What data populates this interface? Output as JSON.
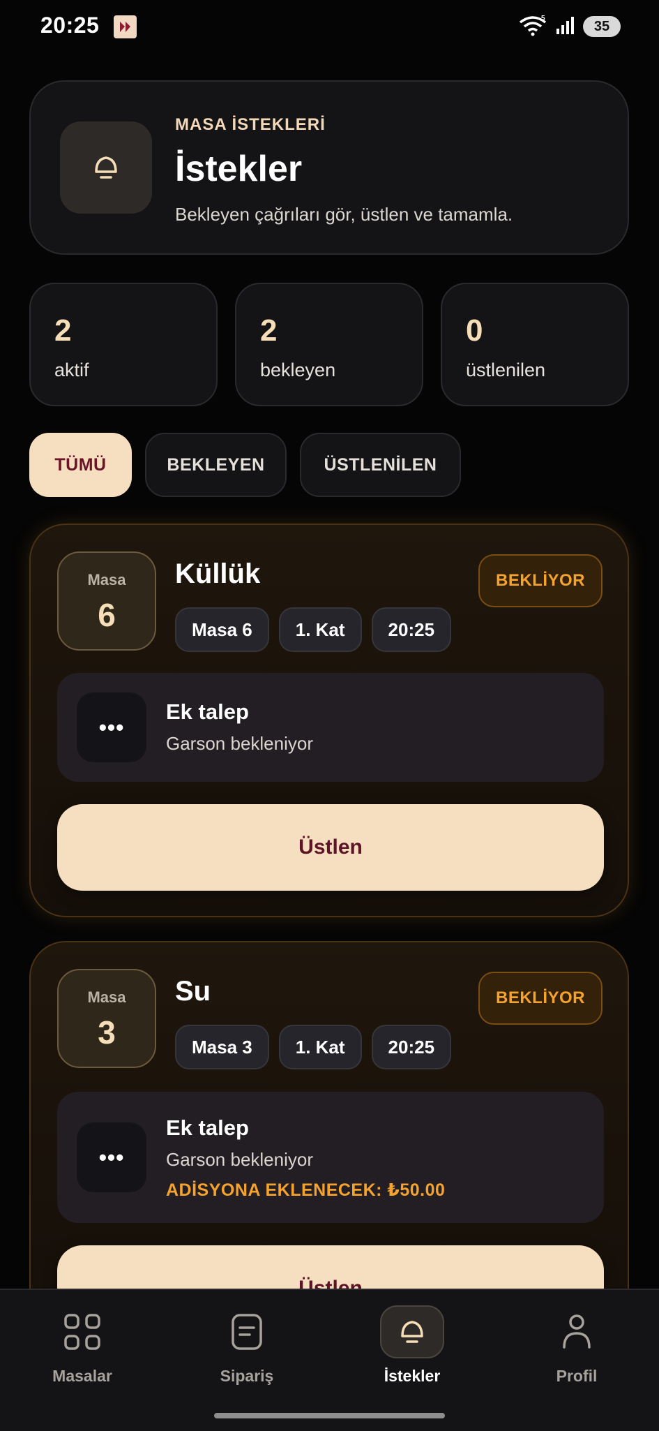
{
  "status_bar": {
    "time": "20:25",
    "battery": "35",
    "icons": [
      "app-notification-icon",
      "wifi-icon",
      "signal-icon",
      "battery-icon"
    ]
  },
  "header": {
    "kicker": "MASA İSTEKLERİ",
    "title": "İstekler",
    "subtitle": "Bekleyen çağrıları gör, üstlen ve tamamla.",
    "icon": "bell-icon"
  },
  "stats": [
    {
      "value": "2",
      "label": "aktif"
    },
    {
      "value": "2",
      "label": "bekleyen"
    },
    {
      "value": "0",
      "label": "üstlenilen"
    }
  ],
  "filters": [
    {
      "label": "TÜMÜ",
      "active": true
    },
    {
      "label": "BEKLEYEN",
      "active": false
    },
    {
      "label": "ÜSTLENİLEN",
      "active": false
    }
  ],
  "requests": [
    {
      "table_label": "Masa",
      "table_number": "6",
      "title": "Küllük",
      "status": "BEKLİYOR",
      "chips": [
        "Masa 6",
        "1. Kat",
        "20:25"
      ],
      "detail_icon": "•••",
      "detail_title": "Ek talep",
      "detail_subtitle": "Garson bekleniyor",
      "detail_extra": "",
      "action_label": "Üstlen"
    },
    {
      "table_label": "Masa",
      "table_number": "3",
      "title": "Su",
      "status": "BEKLİYOR",
      "chips": [
        "Masa 3",
        "1. Kat",
        "20:25"
      ],
      "detail_icon": "•••",
      "detail_title": "Ek talep",
      "detail_subtitle": "Garson bekleniyor",
      "detail_extra": "ADİSYONA EKLENECEK: ₺50.00",
      "action_label": "Üstlen"
    }
  ],
  "bottom_nav": [
    {
      "label": "Masalar",
      "icon": "grid-icon",
      "active": false
    },
    {
      "label": "Sipariş",
      "icon": "document-icon",
      "active": false
    },
    {
      "label": "İstekler",
      "icon": "bell-icon",
      "active": true
    },
    {
      "label": "Profil",
      "icon": "person-icon",
      "active": false
    }
  ],
  "colors": {
    "background": "#050505",
    "card": "#141417",
    "accent": "#f5dfc0",
    "accent_text": "#5c1426",
    "warning": "#f5a32d"
  }
}
